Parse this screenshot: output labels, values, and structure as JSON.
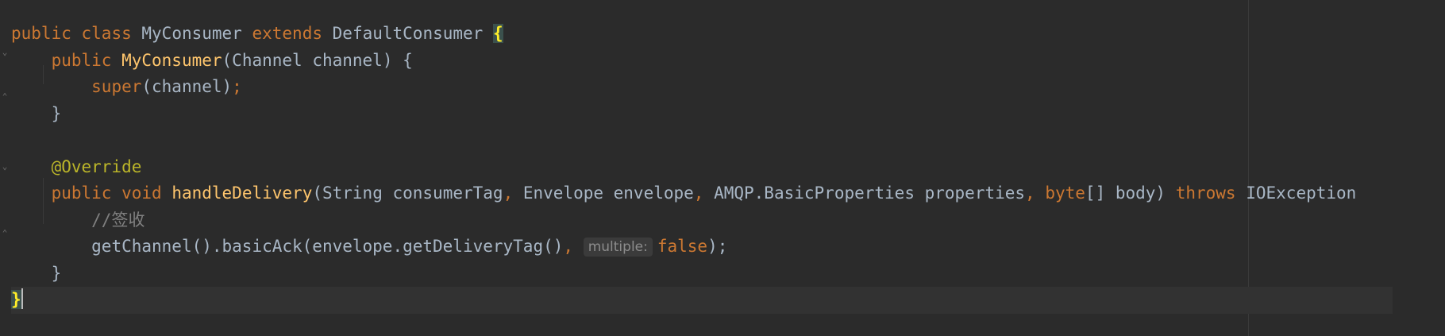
{
  "code": {
    "line1": {
      "kw1": "public",
      "kw2": "class",
      "name": "MyConsumer",
      "kw3": "extends",
      "parent": "DefaultConsumer",
      "brace": "{"
    },
    "line2": {
      "kw1": "public",
      "ctor": "MyConsumer",
      "params": "(Channel channel) {"
    },
    "line3": {
      "kw": "super",
      "args": "(channel)",
      "semi": ";"
    },
    "line4": {
      "brace": "}"
    },
    "line6": {
      "annotation": "@Override"
    },
    "line7": {
      "kw1": "public",
      "kw2": "void",
      "method": "handleDelivery",
      "p1": "(String consumerTag",
      "c1": ",",
      "p2": " Envelope envelope",
      "c2": ",",
      "p3": " AMQP.BasicProperties properties",
      "c3": ",",
      "kw3": "byte",
      "p4": "[] body) ",
      "kw4": "throws",
      "exc": "IOException"
    },
    "line8": {
      "comment": "//签收"
    },
    "line9": {
      "call": "getChannel().basicAck(envelope.getDeliveryTag()",
      "comma": ",",
      "hint": "multiple:",
      "value": "false",
      "end": ");"
    },
    "line10": {
      "brace": "}"
    },
    "line11": {
      "brace": "}"
    }
  }
}
